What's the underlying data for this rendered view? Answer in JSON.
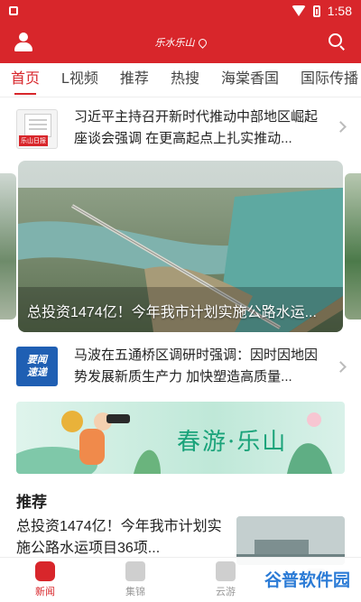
{
  "status": {
    "time": "1:58"
  },
  "appbar": {
    "logo_text": "乐水乐山"
  },
  "tabs": [
    "首页",
    "L视频",
    "推荐",
    "热搜",
    "海棠香国",
    "国际传播"
  ],
  "news": [
    {
      "title": "习近平主持召开新时代推动中部地区崛起座谈会强调 在更高起点上扎实推动...",
      "thumb_tag": "乐山日报"
    },
    {
      "title": "马波在五通桥区调研时强调：因时因地因势发展新质生产力 加快塑造高质量...",
      "thumb_text": [
        "要闻",
        "速递"
      ]
    }
  ],
  "carousel": {
    "caption": "总投资1474亿！今年我市计划实施公路水运..."
  },
  "banner": {
    "text": "春游·乐山"
  },
  "recommend": {
    "section_title": "推荐",
    "item_title": "总投资1474亿！今年我市计划实施公路水运项目36项..."
  },
  "bottom_nav": [
    {
      "label": "新闻",
      "active": true
    },
    {
      "label": "集锦",
      "active": false
    },
    {
      "label": "云游",
      "active": false
    },
    {
      "label": "",
      "active": false
    }
  ],
  "watermark": {
    "text": "谷普软件园"
  },
  "colors": {
    "brand": "#d8262b",
    "banner_text": "#1aa37a"
  }
}
